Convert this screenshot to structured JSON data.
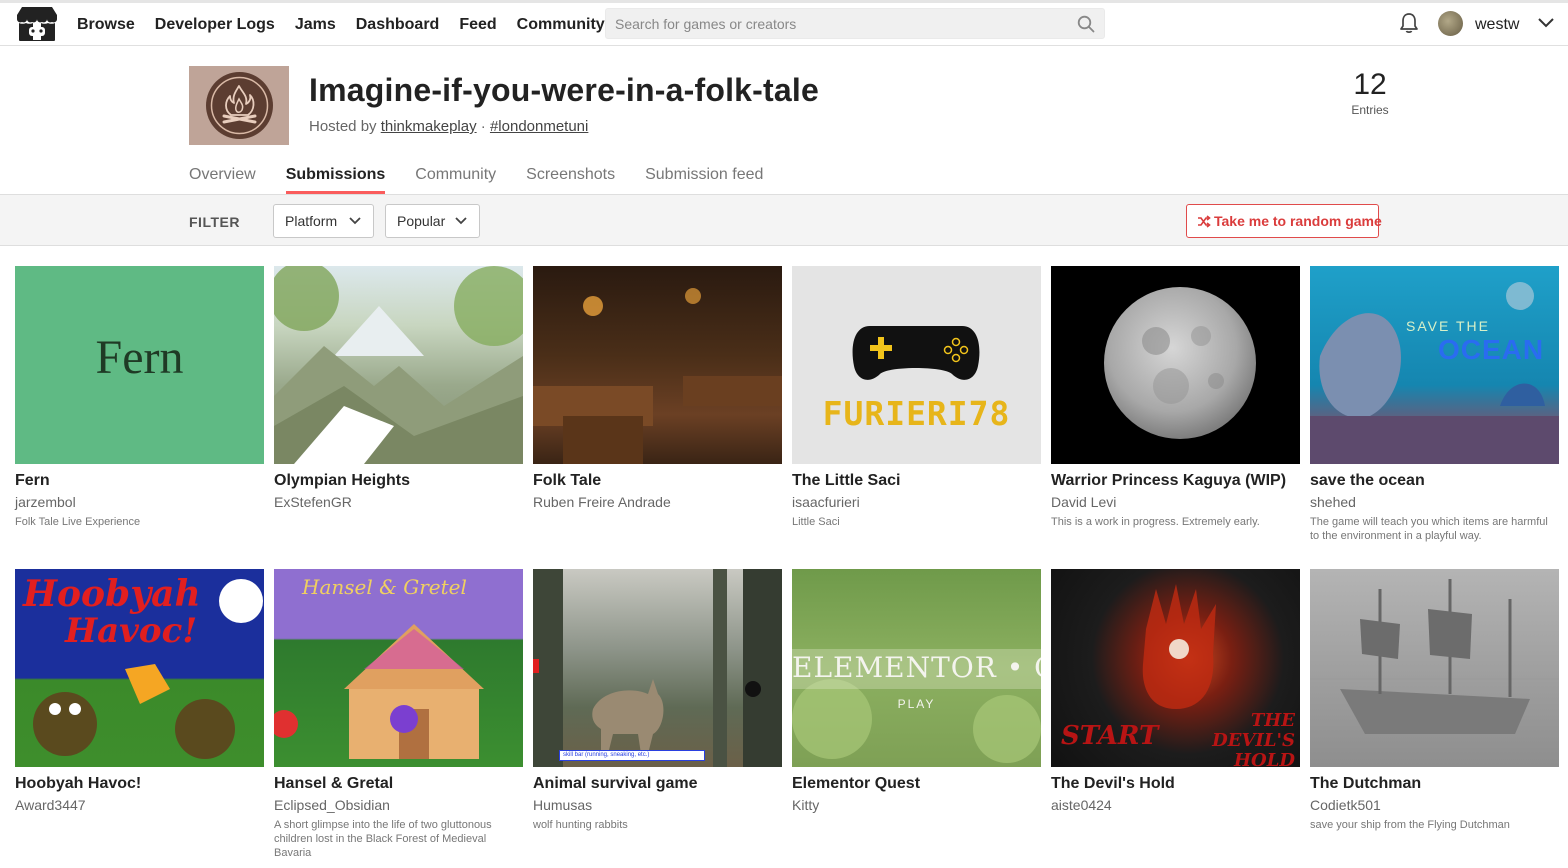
{
  "nav": {
    "items": [
      "Browse",
      "Developer Logs",
      "Jams",
      "Dashboard",
      "Feed",
      "Community"
    ],
    "search_placeholder": "Search for games or creators",
    "username": "westw"
  },
  "jam": {
    "title": "Imagine-if-you-were-in-a-folk-tale",
    "hosted_prefix": "Hosted by",
    "host": "thinkmakeplay",
    "separator": "·",
    "hashtag": "#londonmetuni",
    "entries_count": "12",
    "entries_label": "Entries"
  },
  "tabs": [
    "Overview",
    "Submissions",
    "Community",
    "Screenshots",
    "Submission feed"
  ],
  "active_tab": "Submissions",
  "filter": {
    "label": "FILTER",
    "platform": "Platform",
    "sort": "Popular",
    "random_button": "Take me to random game"
  },
  "games": [
    {
      "title": "Fern",
      "author": "jarzembol",
      "desc": "Folk Tale Live Experience",
      "thumb_text": "Fern"
    },
    {
      "title": "Olympian Heights",
      "author": "ExStefenGR",
      "desc": ""
    },
    {
      "title": "Folk Tale",
      "author": "Ruben Freire Andrade",
      "desc": ""
    },
    {
      "title": "The Little Saci",
      "author": "isaacfurieri",
      "desc": "Little Saci",
      "thumb_text": "FURIERI78"
    },
    {
      "title": "Warrior Princess Kaguya (WIP)",
      "author": "David Levi",
      "desc": "This is a work in progress. Extremely early."
    },
    {
      "title": "save the ocean",
      "author": "shehed",
      "desc": "The game will teach you which items are harmful to the environment in a playful way.",
      "thumb_text_1": "SAVE THE",
      "thumb_text_2": "OCEAN"
    },
    {
      "title": "Hoobyah Havoc!",
      "author": "Award3447",
      "desc": "",
      "thumb_text_1": "Hoobyah",
      "thumb_text_2": "Havoc!"
    },
    {
      "title": "Hansel & Gretal",
      "author": "Eclipsed_Obsidian",
      "desc": "A short glimpse into the life of two gluttonous children lost in the Black Forest of Medieval Bavaria",
      "thumb_text": "Hansel & Gretel"
    },
    {
      "title": "Animal survival game",
      "author": "Humusas",
      "desc": "wolf hunting rabbits",
      "thumb_text": "skill bar (running, sneaking, etc.)"
    },
    {
      "title": "Elementor Quest",
      "author": "Kitty",
      "desc": "",
      "thumb_text_1": "ELEMENTOR • QUEST",
      "thumb_text_2": "PLAY"
    },
    {
      "title": "The Devil's Hold",
      "author": "aiste0424",
      "desc": "",
      "thumb_text_1": "START",
      "thumb_text_2": "THE DEVIL'S HOLD"
    },
    {
      "title": "The Dutchman",
      "author": "Codietk501",
      "desc": "save your ship from the Flying Dutchman"
    }
  ]
}
